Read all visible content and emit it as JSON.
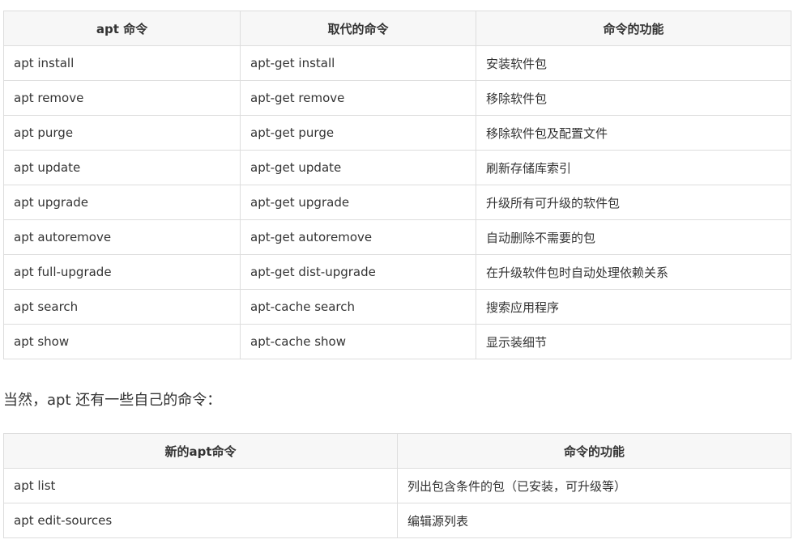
{
  "table1": {
    "headers": [
      "apt 命令",
      "取代的命令",
      "命令的功能"
    ],
    "rows": [
      [
        "apt install",
        "apt-get install",
        "安装软件包"
      ],
      [
        "apt remove",
        "apt-get remove",
        "移除软件包"
      ],
      [
        "apt purge",
        "apt-get purge",
        "移除软件包及配置文件"
      ],
      [
        "apt update",
        "apt-get update",
        "刷新存储库索引"
      ],
      [
        "apt upgrade",
        "apt-get upgrade",
        "升级所有可升级的软件包"
      ],
      [
        "apt autoremove",
        "apt-get autoremove",
        "自动删除不需要的包"
      ],
      [
        "apt full-upgrade",
        "apt-get dist-upgrade",
        "在升级软件包时自动处理依赖关系"
      ],
      [
        "apt search",
        "apt-cache search",
        "搜索应用程序"
      ],
      [
        "apt show",
        "apt-cache show",
        "显示装细节"
      ]
    ]
  },
  "middle_text": "当然，apt 还有一些自己的命令：",
  "table2": {
    "headers": [
      "新的apt命令",
      "命令的功能"
    ],
    "rows": [
      [
        "apt list",
        "列出包含条件的包（已安装，可升级等）"
      ],
      [
        "apt edit-sources",
        "编辑源列表"
      ]
    ]
  }
}
